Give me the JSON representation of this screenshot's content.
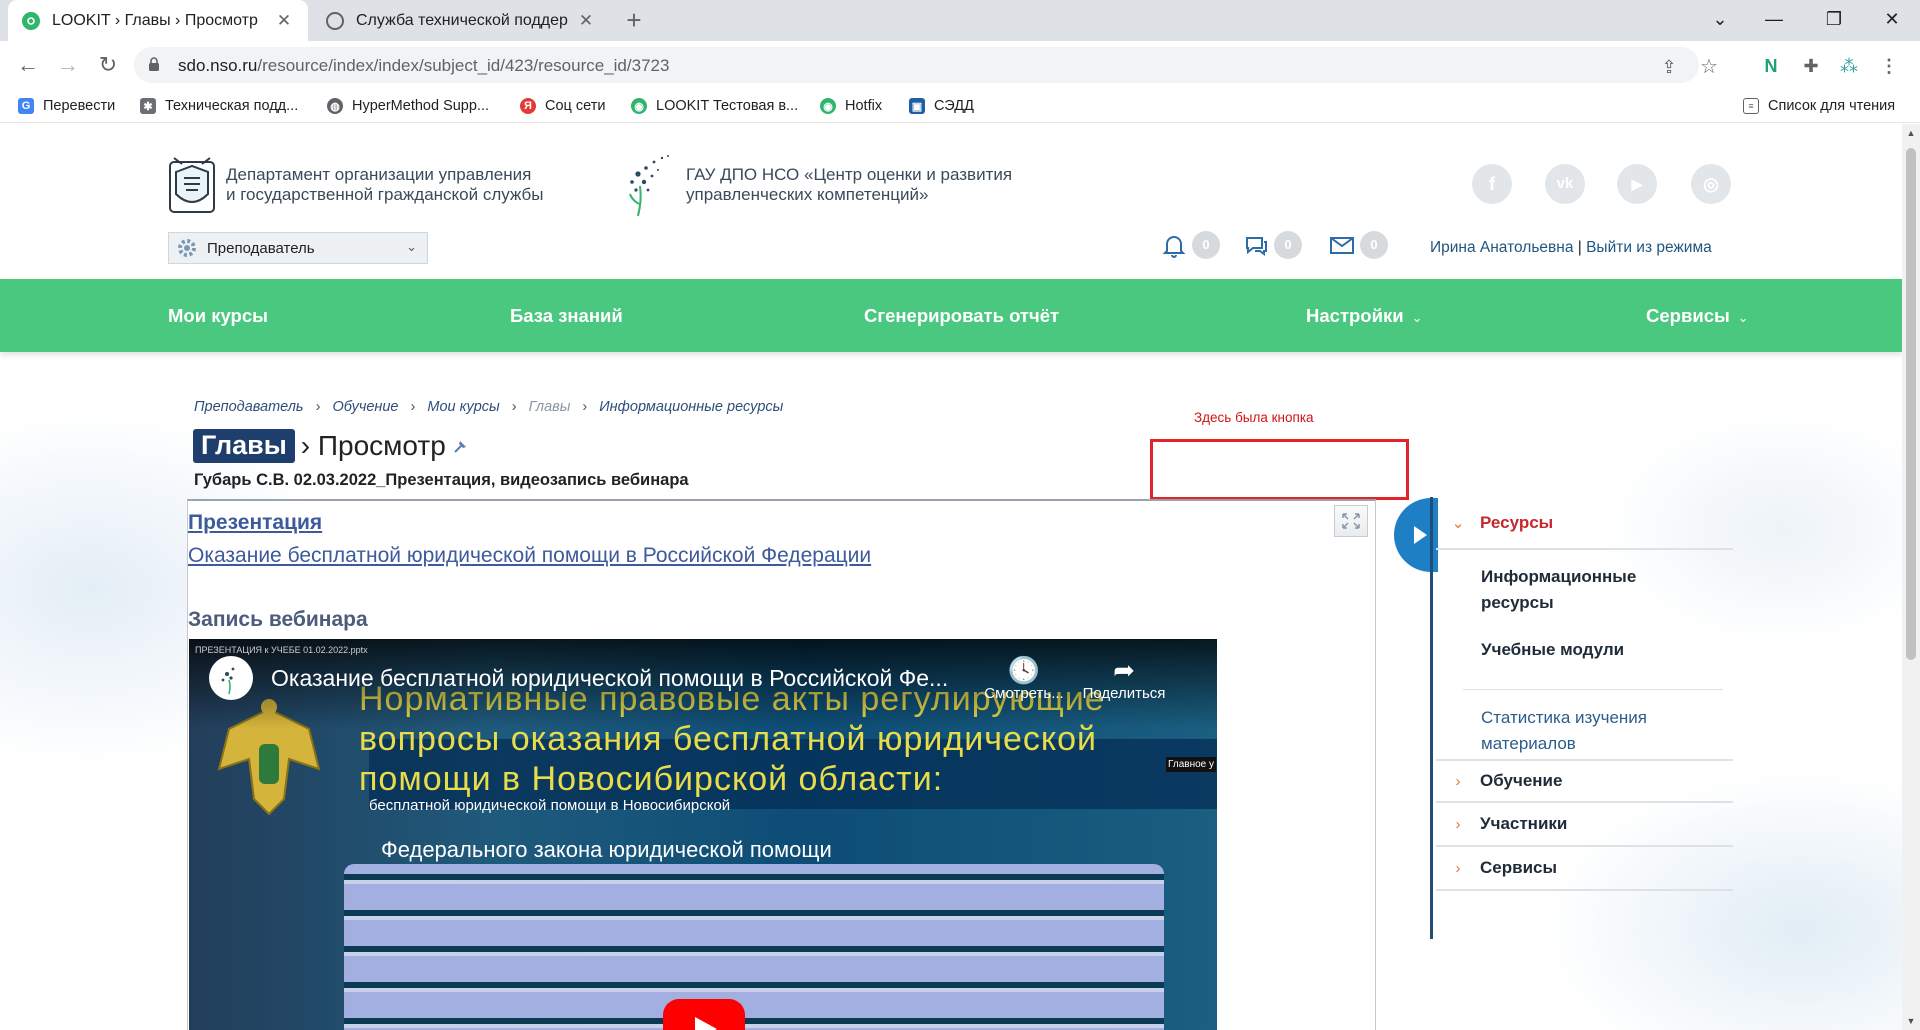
{
  "browser": {
    "tabs": [
      {
        "title": "LOOKIT › Главы › Просмотр",
        "active": true
      },
      {
        "title": "Служба технической поддержки",
        "active": false
      }
    ],
    "new_tab_label": "+",
    "window_controls": {
      "collapse": "⌄",
      "minimize": "—",
      "restore": "❐",
      "close": "✕"
    },
    "url_host": "sdo.nso.ru",
    "url_path": "/resource/index/index/subject_id/423/resource_id/3723",
    "bookmarks": [
      {
        "label": "Перевести",
        "color": "#4285f4",
        "glyph": "G"
      },
      {
        "label": "Техническая подд...",
        "color": "#5f6368",
        "glyph": "✱"
      },
      {
        "label": "HyperMethod Supp...",
        "color": "#5f6368",
        "glyph": "◍"
      },
      {
        "label": "Соц сети",
        "color": "#e53935",
        "glyph": "Я"
      },
      {
        "label": "LOOKIT Тестовая в...",
        "color": "#2fb56c",
        "glyph": "◉"
      },
      {
        "label": "Hotfix",
        "color": "#2fb56c",
        "glyph": "◉"
      },
      {
        "label": "СЭДД",
        "color": "#1f5fa8",
        "glyph": "▣"
      }
    ],
    "reading_list": "Список для чтения"
  },
  "header": {
    "org1_line1": "Департамент организации управления",
    "org1_line2": "и государственной гражданской службы",
    "org2_line1": "ГАУ ДПО НСО «Центр оценки и развития",
    "org2_line2": "управленческих компетенций»",
    "role": "Преподаватель",
    "social": [
      {
        "name": "facebook-icon",
        "glyph": "f"
      },
      {
        "name": "vk-icon",
        "glyph": "vk"
      },
      {
        "name": "youtube-icon",
        "glyph": "▶"
      },
      {
        "name": "instagram-icon",
        "glyph": "◎"
      }
    ],
    "notifications": "0",
    "messages": "0",
    "mail": "0",
    "user_name": "Ирина Анатольевна",
    "user_sep": " | ",
    "exit_label": "Выйти из режима"
  },
  "nav": {
    "items": [
      "Мои курсы",
      "База знаний",
      "Сгенерировать отчёт",
      "Настройки",
      "Сервисы"
    ],
    "dropdown_glyph": "⌄"
  },
  "breadcrumbs": [
    "Преподаватель",
    "Обучение",
    "Мои курсы",
    "Главы",
    "Информационные ресурсы"
  ],
  "breadcrumb_sep": "›",
  "title": {
    "badge": "Главы",
    "rest": "› Просмотр"
  },
  "subtitle": "Губарь С.В. 02.03.2022_Презентация, видеозапись вебинара",
  "annotation": "Здесь была кнопка",
  "content": {
    "presentation_heading": "Презентация",
    "presentation_link": "Оказание бесплатной юридической помощи в Российской Федерации",
    "webinar_heading": "Запись вебинара",
    "video": {
      "title": "Оказание бесплатной юридической помощи в Российской Фе...",
      "watch_later": "Смотреть...",
      "share": "Поделиться",
      "watch_later_icon": "🕓",
      "share_icon": "➦",
      "slide_text": "Нормативные правовые акты регулирующие вопросы оказания бесплатной юридической помощи в Новосибирской области:",
      "slide_small": "бесплатной юридической помощи в Новосибирской",
      "slide_mid": "Федерального закона юридической помощи",
      "side_caption": "Главное у",
      "filename": "ПРЕЗЕНТАЦИЯ к УЧЕБЕ 01.02.2022.pptx"
    }
  },
  "sidebar": {
    "sections": [
      {
        "label": "Ресурсы",
        "open": true
      },
      {
        "label": "Обучение",
        "open": false
      },
      {
        "label": "Участники",
        "open": false
      },
      {
        "label": "Сервисы",
        "open": false
      }
    ],
    "arrow_open": "⌄",
    "arrow_closed": "›",
    "subitems": [
      {
        "label_line1": "Информационные",
        "label_line2": "ресурсы",
        "bold": true
      },
      {
        "label_line1": "Учебные модули",
        "label_line2": "",
        "bold": true
      },
      {
        "label_line1": "Статистика изучения",
        "label_line2": "материалов",
        "bold": false
      }
    ]
  },
  "colors": {
    "nav_green": "#4bc880",
    "accent_blue": "#1f7fc4",
    "annotation_red": "#e0242a",
    "badge_navy": "#1e3e6e"
  }
}
